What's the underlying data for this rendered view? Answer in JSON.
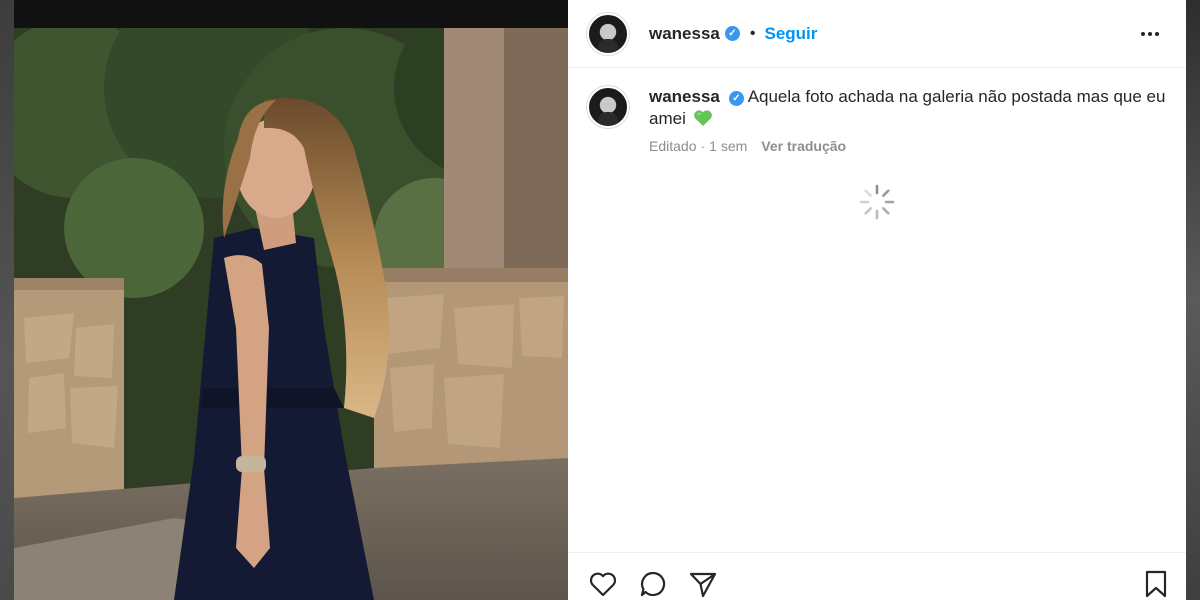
{
  "post": {
    "author": "wanessa",
    "verified": true,
    "separator": "•",
    "follow_label": "Seguir",
    "caption": "Aquela foto achada na galeria não postada mas que eu amei",
    "caption_emoji": "green-heart",
    "edited_label": "Editado",
    "meta_separator": "·",
    "time_ago": "1 sem",
    "translate_label": "Ver tradução"
  },
  "icons": {
    "more": "more-options-icon",
    "like": "heart-icon",
    "comment": "comment-icon",
    "share": "send-icon",
    "save": "bookmark-icon",
    "loading": "loading-spinner-icon"
  },
  "colors": {
    "accent": "#0095f6",
    "verified": "#3897f0",
    "text": "#262626",
    "muted": "#8e8e8e",
    "emoji_green": "#62c554"
  }
}
